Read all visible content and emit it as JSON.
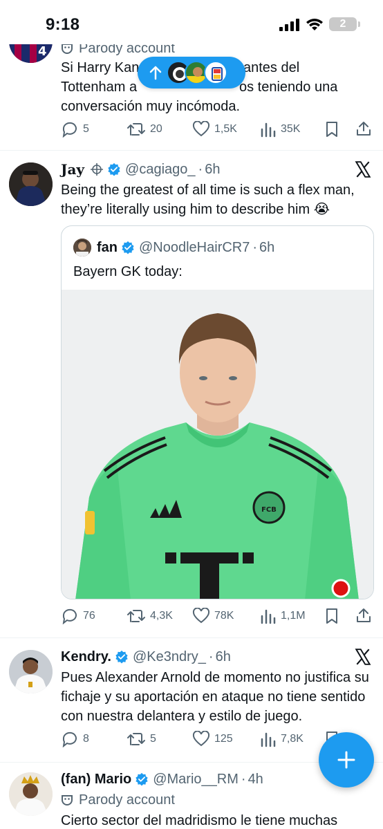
{
  "status_bar": {
    "time": "9:18",
    "battery": "2"
  },
  "colors": {
    "accent": "#1d9bf0",
    "muted": "#536471",
    "text": "#0f1419",
    "border": "#eff3f4"
  },
  "tweets": [
    {
      "id": "tweet-top",
      "parody_label": "Parody account",
      "text": "Si Harry Kane ... antes del Tottenham a... teniendo una conversación muy incómoda.",
      "text_lines": [
        "Si Harry Kan",
        "antes del",
        "Tottenham a",
        "os teniendo una",
        "conversación muy incómoda."
      ],
      "replies": "5",
      "reposts": "20",
      "likes": "1,5K",
      "views": "35K"
    },
    {
      "id": "tweet-jay",
      "name": "Jay",
      "handle": "@cagiago_",
      "time": "6h",
      "text": "Being the greatest of all time is such a flex man, they’re literally using him to describe him 😭",
      "quote": {
        "name": "fan",
        "handle": "@NoodleHairCR7",
        "time": "6h",
        "text": "Bayern GK today:",
        "image_alt": "Goalkeeper in green Bayern jersey with T logo"
      },
      "replies": "76",
      "reposts": "4,3K",
      "likes": "78K",
      "views": "1,1M"
    },
    {
      "id": "tweet-kendry",
      "name": "Kendry.",
      "handle": "@Ke3ndry_",
      "time": "6h",
      "text": "Pues Alexander Arnold de momento no justifica su fichaje y su aportación en ataque no tiene sentido con nuestra delantera y estilo de juego.",
      "replies": "8",
      "reposts": "5",
      "likes": "125",
      "views": "7,8K"
    },
    {
      "id": "tweet-mario",
      "name": "(fan) Mario",
      "handle": "@Mario__RM",
      "time": "4h",
      "parody_label": "Parody account",
      "text": "Cierto sector del madridismo le tiene muchas"
    }
  ],
  "separator": "·",
  "fab_icon": "plus-icon",
  "pill_icon": "arrow-up-icon"
}
